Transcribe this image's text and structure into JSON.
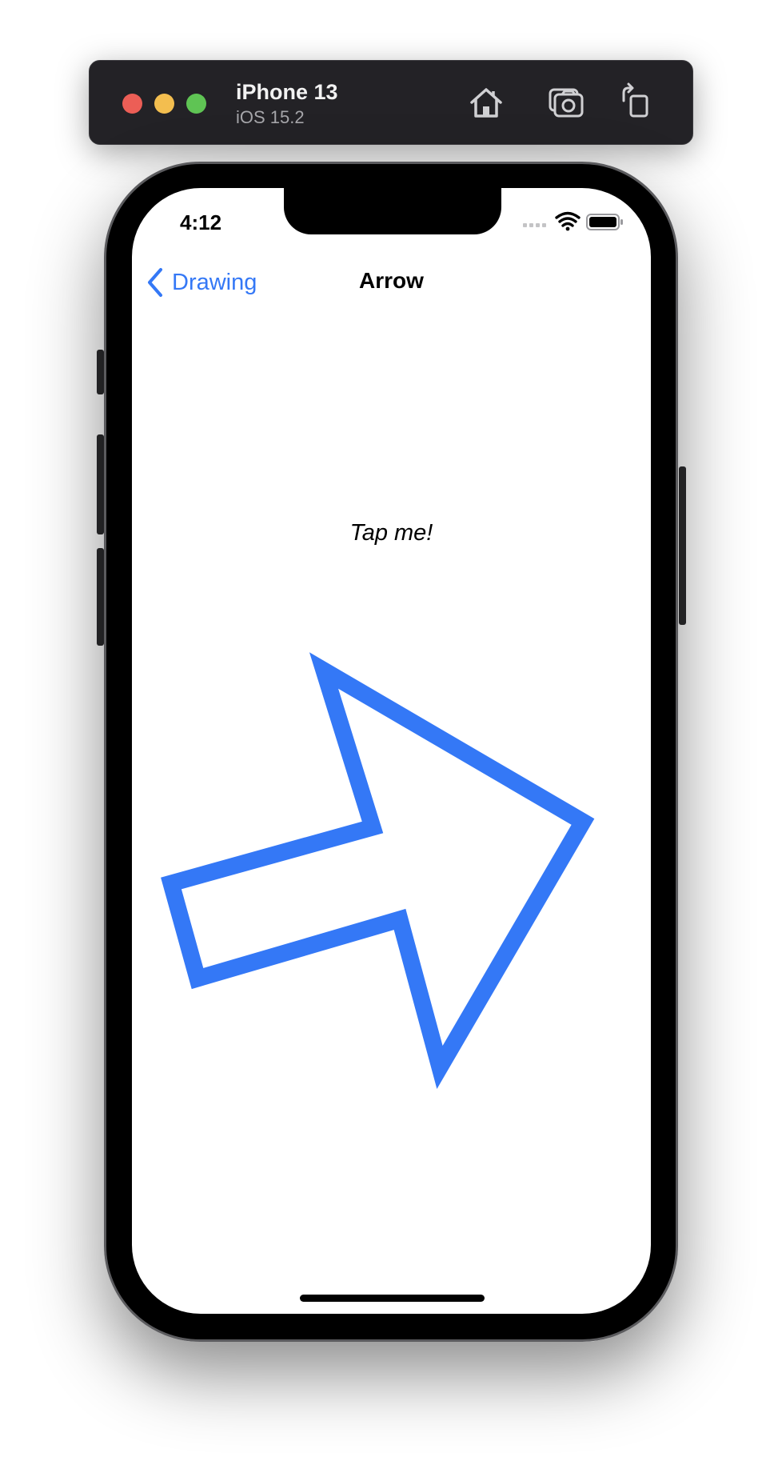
{
  "simulator": {
    "device_name": "iPhone 13",
    "os_version": "iOS 15.2"
  },
  "status_bar": {
    "time": "4:12"
  },
  "nav": {
    "back_label": "Drawing",
    "title": "Arrow"
  },
  "content": {
    "prompt": "Tap me!"
  },
  "colors": {
    "accent": "#3478f6",
    "arrow_stroke": "#3478f6",
    "toolbar_bg": "#232226"
  },
  "icons": {
    "toolbar": [
      "home-icon",
      "screenshot-icon",
      "rotate-icon"
    ],
    "status": [
      "cellular-icon",
      "wifi-icon",
      "battery-icon"
    ],
    "nav": "chevron-left-icon"
  }
}
